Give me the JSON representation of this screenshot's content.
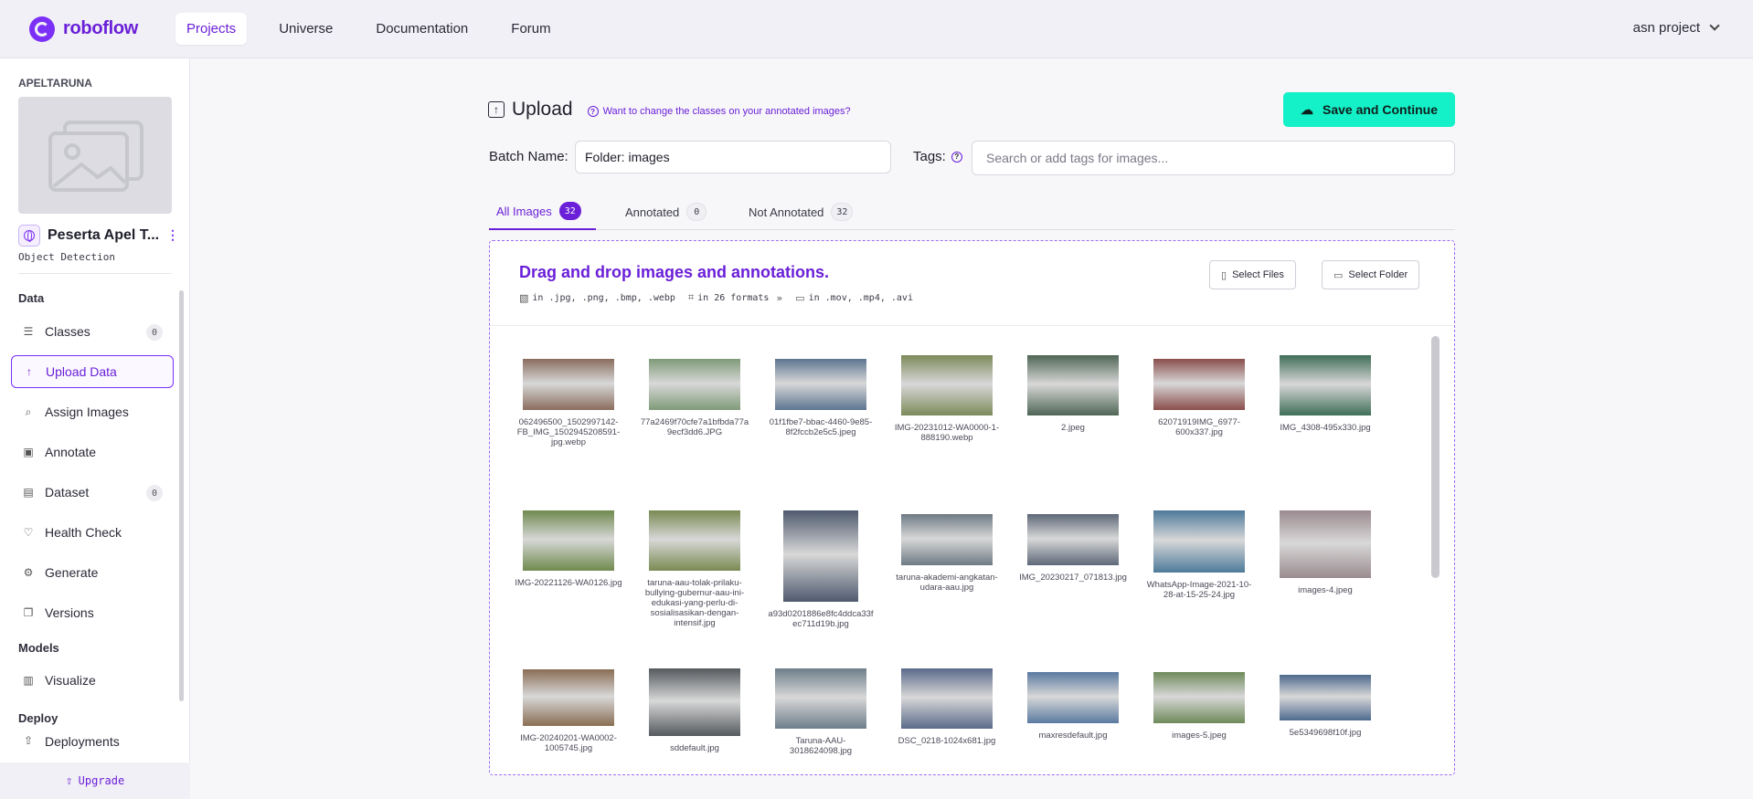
{
  "nav": {
    "logo_text": "roboflow",
    "links": [
      "Projects",
      "Universe",
      "Documentation",
      "Forum"
    ],
    "active_link": "Projects",
    "project_menu": "asn project"
  },
  "sidebar": {
    "workspace": "APELTARUNA",
    "project_name": "Peserta Apel T...",
    "project_type": "Object Detection",
    "sections": {
      "data": "Data",
      "models": "Models",
      "deploy": "Deploy"
    },
    "items": [
      {
        "label": "Classes",
        "icon": "list-icon",
        "badge": "0"
      },
      {
        "label": "Upload Data",
        "icon": "upload-arrow-icon",
        "active": true
      },
      {
        "label": "Assign Images",
        "icon": "search-icon"
      },
      {
        "label": "Annotate",
        "icon": "annotate-icon"
      },
      {
        "label": "Dataset",
        "icon": "images-icon",
        "badge": "0"
      },
      {
        "label": "Health Check",
        "icon": "heart-icon"
      },
      {
        "label": "Generate",
        "icon": "generate-icon"
      },
      {
        "label": "Versions",
        "icon": "versions-icon"
      },
      {
        "label": "Visualize",
        "icon": "chart-icon"
      },
      {
        "label": "Deployments",
        "icon": "deploy-icon"
      }
    ],
    "upgrade": "Upgrade"
  },
  "upload": {
    "title": "Upload",
    "help_link": "Want to change the classes on your annotated images?",
    "save_button": "Save and Continue",
    "batch_label": "Batch Name:",
    "batch_value": "Folder: images",
    "tags_label": "Tags:",
    "tags_placeholder": "Search or add tags for images..."
  },
  "tabs": [
    {
      "label": "All Images",
      "count": "32",
      "active": true
    },
    {
      "label": "Annotated",
      "count": "0"
    },
    {
      "label": "Not Annotated",
      "count": "32"
    }
  ],
  "dropzone": {
    "title": "Drag and drop images and annotations.",
    "formats_images": "in .jpg, .png, .bmp, .webp",
    "formats_annotations": "in 26 formats",
    "formats_video": "in .mov, .mp4, .avi",
    "select_files": "Select Files",
    "select_folder": "Select Folder"
  },
  "images": [
    {
      "name": "062496500_1502997142-FB_IMG_1502945208591-jpg.webp",
      "color": "#8a6d5e"
    },
    {
      "name": "77a2469f70cfe7a1bfbda77a9ecf3dd6.JPG",
      "color": "#7f9a78"
    },
    {
      "name": "01f1fbe7-bbac-4460-9e85-8f2fccb2e5c5.jpeg",
      "color": "#5d7590"
    },
    {
      "name": "IMG-20231012-WA0000-1-888190.webp",
      "color": "#7d8a5a"
    },
    {
      "name": "2.jpeg",
      "color": "#4f6655"
    },
    {
      "name": "62071919IMG_6977-600x337.jpg",
      "color": "#8a4e4c"
    },
    {
      "name": "IMG_4308-495x330.jpg",
      "color": "#3f6e58"
    },
    {
      "name": "IMG-20221126-WA0126.jpg",
      "color": "#6f8a4e"
    },
    {
      "name": "taruna-aau-tolak-prilaku-bullying-gubernur-aau-ini-edukasi-yang-perlu-di-sosialisasikan-dengan-intensif.jpg",
      "color": "#7a8a52"
    },
    {
      "name": "a93d0201886e8fc4ddca33fec711d19b.jpg",
      "color": "#4e5a6e"
    },
    {
      "name": "taruna-akademi-angkatan-udara-aau.jpg",
      "color": "#6e7a84"
    },
    {
      "name": "IMG_20230217_071813.jpg",
      "color": "#5e6878"
    },
    {
      "name": "WhatsApp-Image-2021-10-28-at-15-25-24.jpg",
      "color": "#4e7a9a"
    },
    {
      "name": "images-4.jpeg",
      "color": "#9a8a8e"
    },
    {
      "name": "IMG-20240201-WA0002-1005745.jpg",
      "color": "#8a6e54"
    },
    {
      "name": "sddefault.jpg",
      "color": "#555a5e"
    },
    {
      "name": "Taruna-AAU-3018624098.jpg",
      "color": "#6e7e8a"
    },
    {
      "name": "DSC_0218-1024x681.jpg",
      "color": "#5a6a8a"
    },
    {
      "name": "maxresdefault.jpg",
      "color": "#5a7aa0"
    },
    {
      "name": "images-5.jpeg",
      "color": "#6e8a5a"
    },
    {
      "name": "5e5349698f10f.jpg",
      "color": "#4e6a8e"
    }
  ]
}
